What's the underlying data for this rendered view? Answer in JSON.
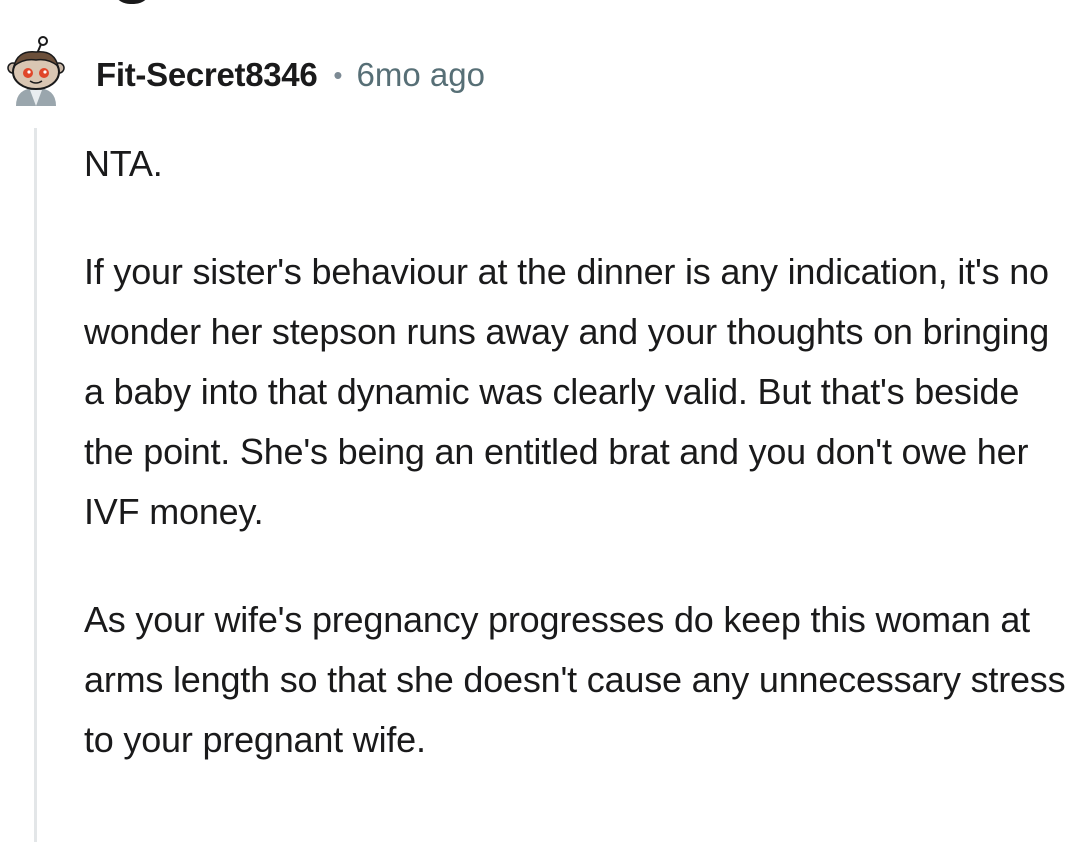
{
  "comment": {
    "username": "Fit-Secret8346",
    "separator": "•",
    "timestamp": "6mo ago",
    "avatar_icon": "snoo-avatar-icon",
    "paragraphs": [
      "NTA.",
      "If your sister's behaviour at the dinner is any indication, it's no wonder her stepson runs away and your thoughts on bringing a baby into that dynamic was clearly valid. But that's beside the point. She's being an entitled brat and you don't owe her IVF money.",
      "As your wife's pregnancy progresses do keep this woman at arms length so that she doesn't cause any unnecessary stress to your pregnant wife."
    ]
  },
  "colors": {
    "text": "#1a1a1b",
    "meta": "#576f76",
    "thread_line": "#e3e6e8"
  }
}
